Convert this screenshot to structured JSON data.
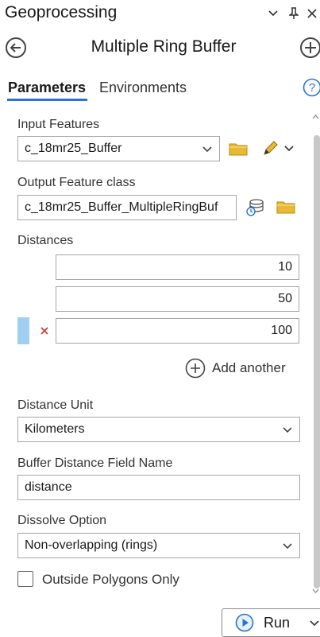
{
  "pane": {
    "title": "Geoprocessing",
    "options_icon": "chevron-down-icon",
    "pin_icon": "pin-icon",
    "close_icon": "close-icon"
  },
  "tool": {
    "title": "Multiple Ring Buffer",
    "back_icon": "back-arrow-icon",
    "add_icon": "add-icon"
  },
  "tabs": [
    {
      "label": "Parameters",
      "active": true
    },
    {
      "label": "Environments",
      "active": false
    }
  ],
  "help_icon": "help-icon",
  "params": {
    "input_features": {
      "label": "Input Features",
      "value": "c_18mr25_Buffer"
    },
    "output_feature_class": {
      "label": "Output Feature class",
      "value": "c_18mr25_Buffer_MultipleRingBuf"
    },
    "distances": {
      "label": "Distances",
      "values": [
        "10",
        "50",
        "100"
      ],
      "add_label": "Add another"
    },
    "distance_unit": {
      "label": "Distance Unit",
      "value": "Kilometers"
    },
    "buffer_field": {
      "label": "Buffer Distance Field Name",
      "value": "distance"
    },
    "dissolve": {
      "label": "Dissolve Option",
      "value": "Non-overlapping (rings)"
    },
    "outside_only": {
      "label": "Outside Polygons Only",
      "checked": false
    }
  },
  "run": {
    "label": "Run"
  },
  "colors": {
    "accent": "#2b74c7",
    "folder": "#e8b935",
    "row_marker": "#9fd0f2",
    "delete": "#d33d2f"
  }
}
